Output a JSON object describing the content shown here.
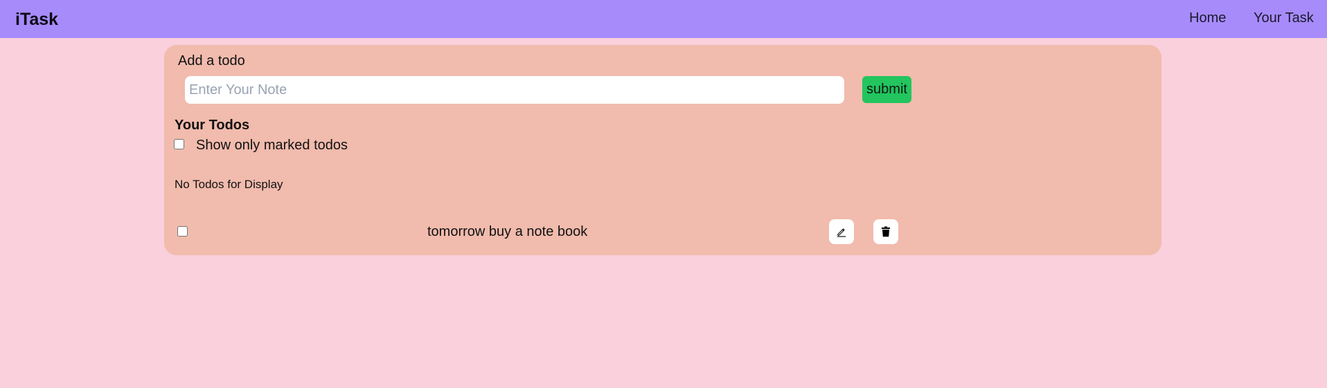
{
  "app": {
    "brand": "iTask"
  },
  "nav": {
    "items": [
      {
        "label": "Home"
      },
      {
        "label": "Your Task"
      }
    ]
  },
  "add_todo": {
    "title": "Add a todo",
    "input_value": "",
    "input_placeholder": "Enter Your Note",
    "submit_label": "submit"
  },
  "todos_section": {
    "heading": "Your Todos",
    "filter_label": "Show only marked todos",
    "filter_checked": false,
    "empty_message": "No Todos for Display",
    "items": [
      {
        "text": "tomorrow buy a note book",
        "checked": false
      }
    ]
  },
  "icons": {
    "edit": "pencil-icon",
    "delete": "trash-icon"
  },
  "colors": {
    "navbar": "#a78bfa",
    "page_background": "#f9d0dc",
    "card_background": "#f1bbad",
    "submit_button": "#22c55e"
  }
}
